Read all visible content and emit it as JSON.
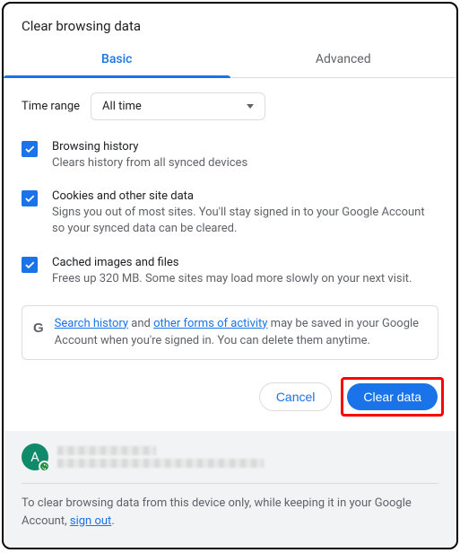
{
  "title": "Clear browsing data",
  "tabs": {
    "basic": "Basic",
    "advanced": "Advanced"
  },
  "time_range": {
    "label": "Time range",
    "value": "All time"
  },
  "options": [
    {
      "title": "Browsing history",
      "desc": "Clears history from all synced devices"
    },
    {
      "title": "Cookies and other site data",
      "desc": "Signs you out of most sites. You'll stay signed in to your Google Account so your synced data can be cleared."
    },
    {
      "title": "Cached images and files",
      "desc": "Frees up 320 MB. Some sites may load more slowly on your next visit."
    }
  ],
  "info": {
    "link1": "Search history",
    "mid": " and ",
    "link2": "other forms of activity",
    "rest": " may be saved in your Google Account when you're signed in. You can delete them anytime."
  },
  "buttons": {
    "cancel": "Cancel",
    "clear": "Clear data"
  },
  "account": {
    "initial": "A"
  },
  "footer": {
    "text_pre": "To clear browsing data from this device only, while keeping it in your Google Account, ",
    "link": "sign out",
    "text_post": "."
  }
}
